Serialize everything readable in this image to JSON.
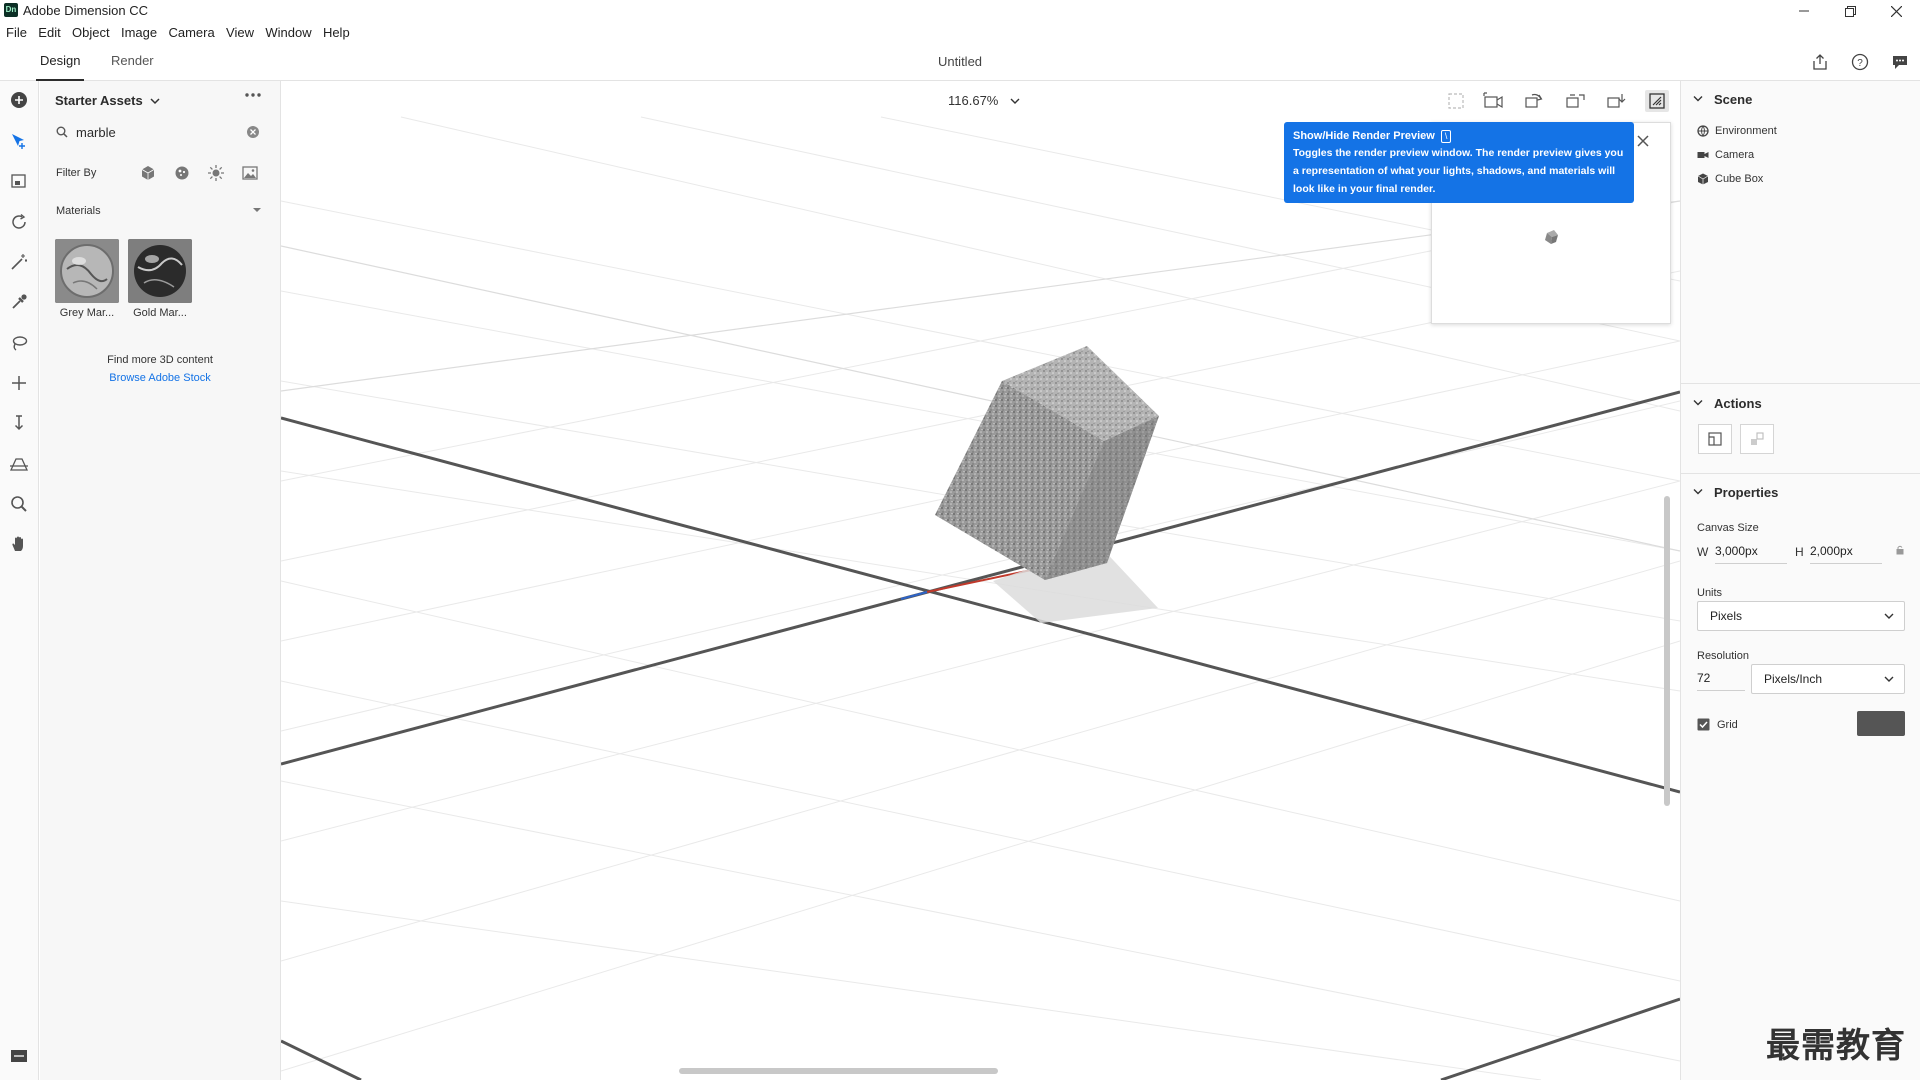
{
  "window": {
    "app_logo_text": "Dn",
    "title": "Adobe Dimension CC"
  },
  "menu": {
    "items": [
      "File",
      "Edit",
      "Object",
      "Image",
      "Camera",
      "View",
      "Window",
      "Help"
    ]
  },
  "tabs": {
    "design": "Design",
    "render": "Render",
    "active": "Design"
  },
  "document": {
    "title": "Untitled"
  },
  "header_icons": [
    "share-icon",
    "help-icon",
    "feedback-icon"
  ],
  "tools": [
    "add-icon",
    "select-icon",
    "frame-icon",
    "orbit-icon",
    "magic-wand-icon",
    "eyedropper-icon",
    "lasso-icon",
    "pan-icon",
    "dolly-icon",
    "horizon-icon",
    "zoom-icon",
    "hand-icon"
  ],
  "assets": {
    "title": "Starter Assets",
    "search_value": "marble",
    "filter_label": "Filter By",
    "filter_icons": [
      "models-filter-icon",
      "materials-filter-icon",
      "lights-filter-icon",
      "images-filter-icon"
    ],
    "section_label": "Materials",
    "materials": [
      {
        "name": "Grey Mar..."
      },
      {
        "name": "Gold Mar..."
      }
    ],
    "find_more": "Find more 3D content",
    "browse_link": "Browse Adobe Stock"
  },
  "viewport": {
    "zoom": "116.67%",
    "toolbar_icons": [
      "frame-selection-icon",
      "camera-view-icon",
      "orbit-view-icon",
      "pan-view-icon",
      "dolly-view-icon",
      "render-preview-toggle-icon"
    ]
  },
  "tooltip": {
    "title": "Show/Hide Render Preview",
    "shortcut": "\\",
    "body": "Toggles the render preview window. The render preview gives you a representation of what your lights, shadows, and materials will look like in your final render."
  },
  "scene": {
    "header": "Scene",
    "items": [
      {
        "label": "Environment",
        "icon": "environment-icon"
      },
      {
        "label": "Camera",
        "icon": "camera-icon"
      },
      {
        "label": "Cube Box",
        "icon": "cube-icon"
      }
    ]
  },
  "actions": {
    "header": "Actions",
    "icons": [
      "fit-canvas-icon",
      "align-icon"
    ]
  },
  "properties": {
    "header": "Properties",
    "canvas_size_label": "Canvas Size",
    "width_label": "W",
    "width": "3,000px",
    "height_label": "H",
    "height": "2,000px",
    "units_label": "Units",
    "units_value": "Pixels",
    "resolution_label": "Resolution",
    "resolution_value": "72",
    "resolution_units": "Pixels/Inch",
    "grid_label": "Grid",
    "grid_checked": true,
    "grid_color": "#555555"
  },
  "watermark": "最需教育",
  "colors": {
    "accent": "#1473e6",
    "panel_bg": "#fafafa"
  }
}
